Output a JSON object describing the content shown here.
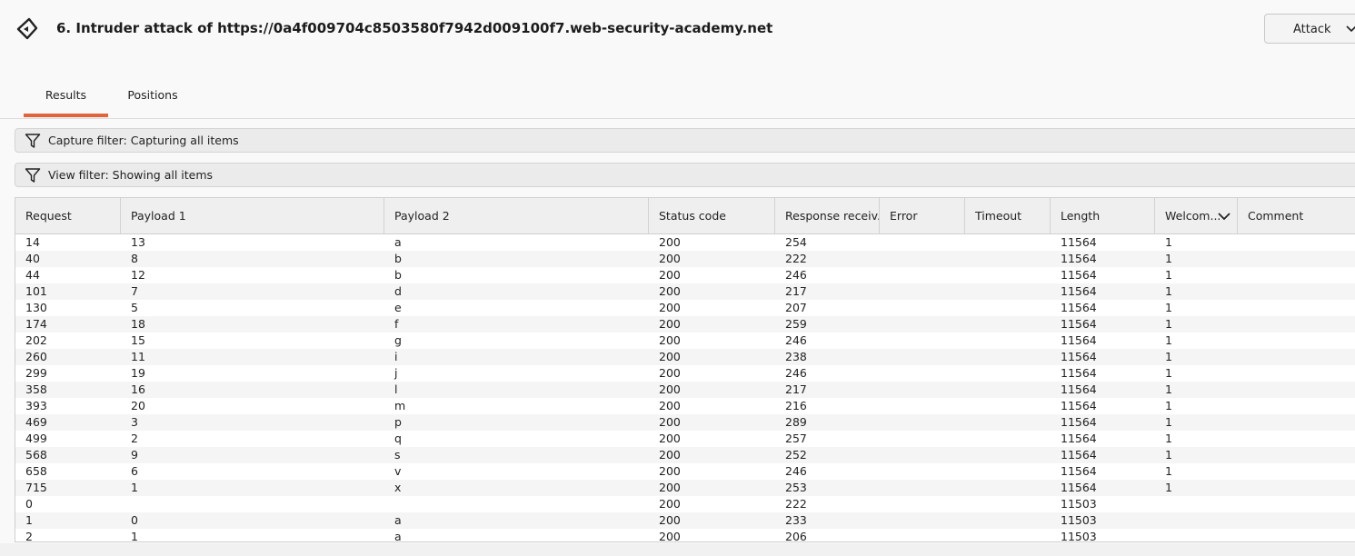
{
  "window": {
    "title": "6. Intruder attack of https://0a4f009704c8503580f7942d009100f7.web-security-academy.net",
    "attack_label": "Attack"
  },
  "tabs": [
    {
      "label": "Results",
      "active": true
    },
    {
      "label": "Positions",
      "active": false
    }
  ],
  "filters": {
    "capture": "Capture filter: Capturing all items",
    "view": "View filter: Showing all items"
  },
  "table": {
    "columns": [
      "Request",
      "Payload 1",
      "Payload 2",
      "Status code",
      "Response receiv...",
      "Error",
      "Timeout",
      "Length",
      "Welcom...",
      "Comment"
    ],
    "sorted_column": "Welcom...",
    "rows": [
      [
        "14",
        "13",
        "a",
        "200",
        "254",
        "",
        "",
        "11564",
        "1",
        ""
      ],
      [
        "40",
        "8",
        "b",
        "200",
        "222",
        "",
        "",
        "11564",
        "1",
        ""
      ],
      [
        "44",
        "12",
        "b",
        "200",
        "246",
        "",
        "",
        "11564",
        "1",
        ""
      ],
      [
        "101",
        "7",
        "d",
        "200",
        "217",
        "",
        "",
        "11564",
        "1",
        ""
      ],
      [
        "130",
        "5",
        "e",
        "200",
        "207",
        "",
        "",
        "11564",
        "1",
        ""
      ],
      [
        "174",
        "18",
        "f",
        "200",
        "259",
        "",
        "",
        "11564",
        "1",
        ""
      ],
      [
        "202",
        "15",
        "g",
        "200",
        "246",
        "",
        "",
        "11564",
        "1",
        ""
      ],
      [
        "260",
        "11",
        "i",
        "200",
        "238",
        "",
        "",
        "11564",
        "1",
        ""
      ],
      [
        "299",
        "19",
        "j",
        "200",
        "246",
        "",
        "",
        "11564",
        "1",
        ""
      ],
      [
        "358",
        "16",
        "l",
        "200",
        "217",
        "",
        "",
        "11564",
        "1",
        ""
      ],
      [
        "393",
        "20",
        "m",
        "200",
        "216",
        "",
        "",
        "11564",
        "1",
        ""
      ],
      [
        "469",
        "3",
        "p",
        "200",
        "289",
        "",
        "",
        "11564",
        "1",
        ""
      ],
      [
        "499",
        "2",
        "q",
        "200",
        "257",
        "",
        "",
        "11564",
        "1",
        ""
      ],
      [
        "568",
        "9",
        "s",
        "200",
        "252",
        "",
        "",
        "11564",
        "1",
        ""
      ],
      [
        "658",
        "6",
        "v",
        "200",
        "246",
        "",
        "",
        "11564",
        "1",
        ""
      ],
      [
        "715",
        "1",
        "x",
        "200",
        "253",
        "",
        "",
        "11564",
        "1",
        ""
      ],
      [
        "0",
        "",
        "",
        "200",
        "222",
        "",
        "",
        "11503",
        "",
        ""
      ],
      [
        "1",
        "0",
        "a",
        "200",
        "233",
        "",
        "",
        "11503",
        "",
        ""
      ],
      [
        "2",
        "1",
        "a",
        "200",
        "206",
        "",
        "",
        "11503",
        "",
        ""
      ]
    ]
  },
  "colors": {
    "accent": "#e2643a",
    "header_bg": "#efefef",
    "row_alt": "#f5f5f5"
  }
}
